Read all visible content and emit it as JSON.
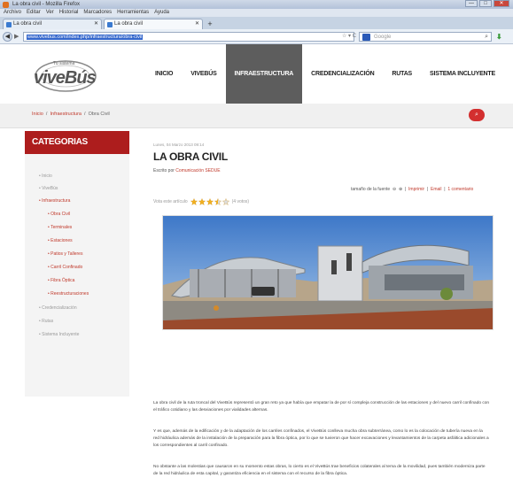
{
  "browser": {
    "window_title": "La obra civil - Mozilla Firefox",
    "menu": [
      "Archivo",
      "Editar",
      "Ver",
      "Historial",
      "Marcadores",
      "Herramientas",
      "Ayuda"
    ],
    "tabs": [
      {
        "label": "La obra civil"
      },
      {
        "label": "La obra civil"
      }
    ],
    "url": "www.vivebus.com/index.php/infraestructura/obra-civil",
    "search_placeholder": "Google",
    "win_min": "—",
    "win_max": "□",
    "win_close": "✕",
    "new_tab": "+",
    "back": "◀",
    "forward": "▶",
    "url_tools": "☆ ▾ C",
    "search_icon": "⌕",
    "addon_icon": "⬇"
  },
  "site": {
    "logo_top": "Tu sistema",
    "logo_text": "viveBús",
    "nav": [
      {
        "label": "INICIO"
      },
      {
        "label": "VIVEBÚS"
      },
      {
        "label": "INFRAESTRUCTURA"
      },
      {
        "label": "CREDENCIALIZACIÓN"
      },
      {
        "label": "RUTAS"
      },
      {
        "label": "SISTEMA INCLUYENTE"
      }
    ],
    "breadcrumb": {
      "home": "Inicio",
      "section": "Infraestructura",
      "current": "Obra Civil",
      "sep": "/"
    },
    "search_icon": "⌕",
    "accent": "#ad1d1d"
  },
  "sidebar": {
    "title": "CATEGORIAS",
    "items": [
      {
        "label": "Inicio"
      },
      {
        "label": "ViveBús"
      },
      {
        "label": "Infraestructura"
      },
      {
        "label": "Obra Civil"
      },
      {
        "label": "Terminales"
      },
      {
        "label": "Estaciones"
      },
      {
        "label": "Patios y Talleres"
      },
      {
        "label": "Carril Confinado"
      },
      {
        "label": "Fibra Óptica"
      },
      {
        "label": "Reestructuraciones"
      },
      {
        "label": "Credencialización"
      },
      {
        "label": "Rutas"
      },
      {
        "label": "Sistema Incluyente"
      }
    ]
  },
  "article": {
    "date": "Lunes, 04 Marzo 2013 09:14",
    "title": "LA OBRA CIVIL",
    "author_label": "Escrito por",
    "author": "Comunicación SEDUE",
    "font_size_label": "tamaño de la fuente",
    "font_size_decrease": "⊖",
    "font_size_increase": "⊕",
    "print": "Imprimir",
    "email": "Email",
    "comments": "1 comentario",
    "tools_sep": "|",
    "rating_label": "Vota este artículo",
    "rating_votes": "(4 votos)",
    "rating_value": 3.5,
    "rating_max": 5,
    "paragraphs": [
      "La obra civil de la ruta troncal del ViveBús representó un gran reto ya que había que empatar la de por sí compleja construcción de las estaciones y del nuevo carril confinado con el tráfico cotidiano y las desviaciones por vialidades alternas.",
      "Y es que, además de la edificación y de la adaptación de los carriles confinados, el ViveBús conlleva mucha obra subterránea, como lo es la colocación de tubería nueva en la red hidráulica además de la instalación de la preparación para la fibra óptica, por lo que se tuvieron que hacer excavaciones y levantamientos de la carpeta asfáltica adicionales a los correspondientes al carril confinado.",
      "No obstante a las molestias que causaron en su momento estas obras, lo cierto es el ViveBús trae beneficios colaterales al tema de la movilidad, pues también moderniza parte de la red hidráulica de esta capital, y garantiza eficiencia en el sistema con el recurso de la fibra óptica."
    ]
  }
}
